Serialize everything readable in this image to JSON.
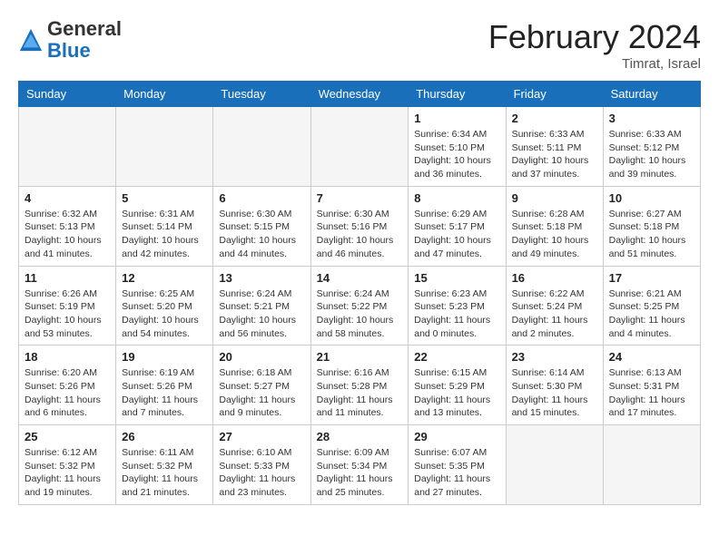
{
  "logo": {
    "general": "General",
    "blue": "Blue"
  },
  "title": "February 2024",
  "location": "Timrat, Israel",
  "days_of_week": [
    "Sunday",
    "Monday",
    "Tuesday",
    "Wednesday",
    "Thursday",
    "Friday",
    "Saturday"
  ],
  "weeks": [
    [
      {
        "day": "",
        "sunrise": "",
        "sunset": "",
        "daylight": ""
      },
      {
        "day": "",
        "sunrise": "",
        "sunset": "",
        "daylight": ""
      },
      {
        "day": "",
        "sunrise": "",
        "sunset": "",
        "daylight": ""
      },
      {
        "day": "",
        "sunrise": "",
        "sunset": "",
        "daylight": ""
      },
      {
        "day": "1",
        "sunrise": "Sunrise: 6:34 AM",
        "sunset": "Sunset: 5:10 PM",
        "daylight": "Daylight: 10 hours and 36 minutes."
      },
      {
        "day": "2",
        "sunrise": "Sunrise: 6:33 AM",
        "sunset": "Sunset: 5:11 PM",
        "daylight": "Daylight: 10 hours and 37 minutes."
      },
      {
        "day": "3",
        "sunrise": "Sunrise: 6:33 AM",
        "sunset": "Sunset: 5:12 PM",
        "daylight": "Daylight: 10 hours and 39 minutes."
      }
    ],
    [
      {
        "day": "4",
        "sunrise": "Sunrise: 6:32 AM",
        "sunset": "Sunset: 5:13 PM",
        "daylight": "Daylight: 10 hours and 41 minutes."
      },
      {
        "day": "5",
        "sunrise": "Sunrise: 6:31 AM",
        "sunset": "Sunset: 5:14 PM",
        "daylight": "Daylight: 10 hours and 42 minutes."
      },
      {
        "day": "6",
        "sunrise": "Sunrise: 6:30 AM",
        "sunset": "Sunset: 5:15 PM",
        "daylight": "Daylight: 10 hours and 44 minutes."
      },
      {
        "day": "7",
        "sunrise": "Sunrise: 6:30 AM",
        "sunset": "Sunset: 5:16 PM",
        "daylight": "Daylight: 10 hours and 46 minutes."
      },
      {
        "day": "8",
        "sunrise": "Sunrise: 6:29 AM",
        "sunset": "Sunset: 5:17 PM",
        "daylight": "Daylight: 10 hours and 47 minutes."
      },
      {
        "day": "9",
        "sunrise": "Sunrise: 6:28 AM",
        "sunset": "Sunset: 5:18 PM",
        "daylight": "Daylight: 10 hours and 49 minutes."
      },
      {
        "day": "10",
        "sunrise": "Sunrise: 6:27 AM",
        "sunset": "Sunset: 5:18 PM",
        "daylight": "Daylight: 10 hours and 51 minutes."
      }
    ],
    [
      {
        "day": "11",
        "sunrise": "Sunrise: 6:26 AM",
        "sunset": "Sunset: 5:19 PM",
        "daylight": "Daylight: 10 hours and 53 minutes."
      },
      {
        "day": "12",
        "sunrise": "Sunrise: 6:25 AM",
        "sunset": "Sunset: 5:20 PM",
        "daylight": "Daylight: 10 hours and 54 minutes."
      },
      {
        "day": "13",
        "sunrise": "Sunrise: 6:24 AM",
        "sunset": "Sunset: 5:21 PM",
        "daylight": "Daylight: 10 hours and 56 minutes."
      },
      {
        "day": "14",
        "sunrise": "Sunrise: 6:24 AM",
        "sunset": "Sunset: 5:22 PM",
        "daylight": "Daylight: 10 hours and 58 minutes."
      },
      {
        "day": "15",
        "sunrise": "Sunrise: 6:23 AM",
        "sunset": "Sunset: 5:23 PM",
        "daylight": "Daylight: 11 hours and 0 minutes."
      },
      {
        "day": "16",
        "sunrise": "Sunrise: 6:22 AM",
        "sunset": "Sunset: 5:24 PM",
        "daylight": "Daylight: 11 hours and 2 minutes."
      },
      {
        "day": "17",
        "sunrise": "Sunrise: 6:21 AM",
        "sunset": "Sunset: 5:25 PM",
        "daylight": "Daylight: 11 hours and 4 minutes."
      }
    ],
    [
      {
        "day": "18",
        "sunrise": "Sunrise: 6:20 AM",
        "sunset": "Sunset: 5:26 PM",
        "daylight": "Daylight: 11 hours and 6 minutes."
      },
      {
        "day": "19",
        "sunrise": "Sunrise: 6:19 AM",
        "sunset": "Sunset: 5:26 PM",
        "daylight": "Daylight: 11 hours and 7 minutes."
      },
      {
        "day": "20",
        "sunrise": "Sunrise: 6:18 AM",
        "sunset": "Sunset: 5:27 PM",
        "daylight": "Daylight: 11 hours and 9 minutes."
      },
      {
        "day": "21",
        "sunrise": "Sunrise: 6:16 AM",
        "sunset": "Sunset: 5:28 PM",
        "daylight": "Daylight: 11 hours and 11 minutes."
      },
      {
        "day": "22",
        "sunrise": "Sunrise: 6:15 AM",
        "sunset": "Sunset: 5:29 PM",
        "daylight": "Daylight: 11 hours and 13 minutes."
      },
      {
        "day": "23",
        "sunrise": "Sunrise: 6:14 AM",
        "sunset": "Sunset: 5:30 PM",
        "daylight": "Daylight: 11 hours and 15 minutes."
      },
      {
        "day": "24",
        "sunrise": "Sunrise: 6:13 AM",
        "sunset": "Sunset: 5:31 PM",
        "daylight": "Daylight: 11 hours and 17 minutes."
      }
    ],
    [
      {
        "day": "25",
        "sunrise": "Sunrise: 6:12 AM",
        "sunset": "Sunset: 5:32 PM",
        "daylight": "Daylight: 11 hours and 19 minutes."
      },
      {
        "day": "26",
        "sunrise": "Sunrise: 6:11 AM",
        "sunset": "Sunset: 5:32 PM",
        "daylight": "Daylight: 11 hours and 21 minutes."
      },
      {
        "day": "27",
        "sunrise": "Sunrise: 6:10 AM",
        "sunset": "Sunset: 5:33 PM",
        "daylight": "Daylight: 11 hours and 23 minutes."
      },
      {
        "day": "28",
        "sunrise": "Sunrise: 6:09 AM",
        "sunset": "Sunset: 5:34 PM",
        "daylight": "Daylight: 11 hours and 25 minutes."
      },
      {
        "day": "29",
        "sunrise": "Sunrise: 6:07 AM",
        "sunset": "Sunset: 5:35 PM",
        "daylight": "Daylight: 11 hours and 27 minutes."
      },
      {
        "day": "",
        "sunrise": "",
        "sunset": "",
        "daylight": ""
      },
      {
        "day": "",
        "sunrise": "",
        "sunset": "",
        "daylight": ""
      }
    ]
  ]
}
